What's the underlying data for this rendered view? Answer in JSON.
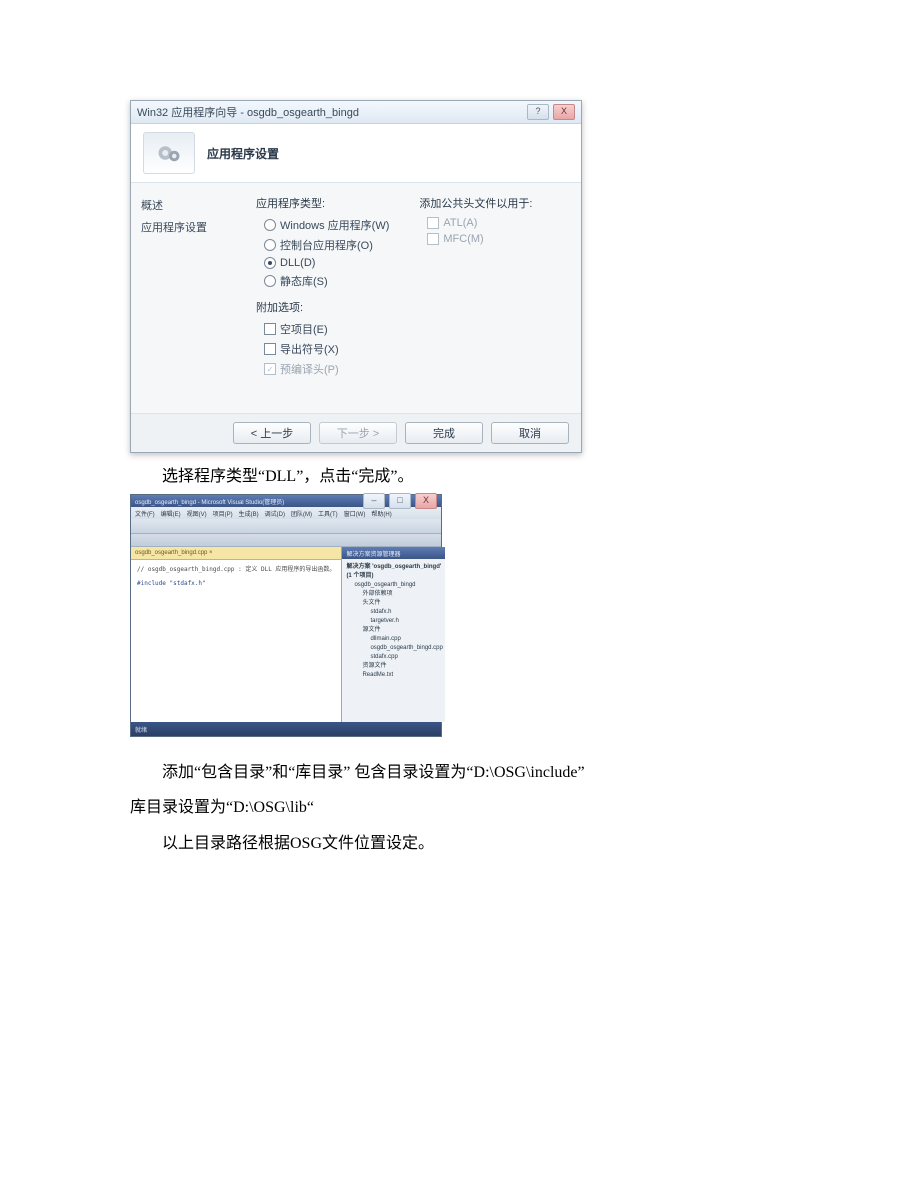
{
  "wizard": {
    "title": "Win32 应用程序向导 - osgdb_osgearth_bingd",
    "header_label": "应用程序设置",
    "sidebar": {
      "item1": "概述",
      "item2": "应用程序设置"
    },
    "app_type_label": "应用程序类型:",
    "opt_windows": "Windows 应用程序(W)",
    "opt_console": "控制台应用程序(O)",
    "opt_dll": "DLL(D)",
    "opt_static": "静态库(S)",
    "extra_label": "附加选项:",
    "opt_empty": "空项目(E)",
    "opt_export": "导出符号(X)",
    "opt_precomp": "预编译头(P)",
    "common_header_label": "添加公共头文件以用于:",
    "opt_atl": "ATL(A)",
    "opt_mfc": "MFC(M)",
    "btn_prev": "< 上一步",
    "btn_next": "下一步 >",
    "btn_finish": "完成",
    "btn_cancel": "取消",
    "win_question": "?",
    "win_close": "X"
  },
  "doc": {
    "line1": "选择程序类型“DLL”，点击“完成”。",
    "line2": "添加“包含目录”和“库目录”  包含目录设置为“D:\\OSG\\include”",
    "line3": "库目录设置为“D:\\OSG\\lib“",
    "line4": "以上目录路径根据OSG文件位置设定。"
  },
  "ide": {
    "title": "osgdb_osgearth_bingd - Microsoft Visual Studio(管理员)",
    "menu": [
      "文件(F)",
      "编辑(E)",
      "视图(V)",
      "项目(P)",
      "生成(B)",
      "调试(D)",
      "团队(M)",
      "工具(T)",
      "窗口(W)",
      "帮助(H)"
    ],
    "tab": "osgdb_osgearth_bingd.cpp ×",
    "code_line1": "// osgdb_osgearth_bingd.cpp : 定义 DLL 应用程序的导出函数。",
    "code_line2": "",
    "code_line3": "#include \"stdafx.h\"",
    "right_title": "解决方案资源管理器",
    "tree": {
      "sol": "解决方案 'osgdb_osgearth_bingd' (1 个项目)",
      "proj": "osgdb_osgearth_bingd",
      "ext": "外部依赖项",
      "hdr": "头文件",
      "hdr1": "stdafx.h",
      "hdr2": "targetver.h",
      "src": "源文件",
      "src1": "dllmain.cpp",
      "src2": "osgdb_osgearth_bingd.cpp",
      "src3": "stdafx.cpp",
      "res": "资源文件",
      "readme": "ReadMe.txt"
    },
    "status": "就绪"
  }
}
